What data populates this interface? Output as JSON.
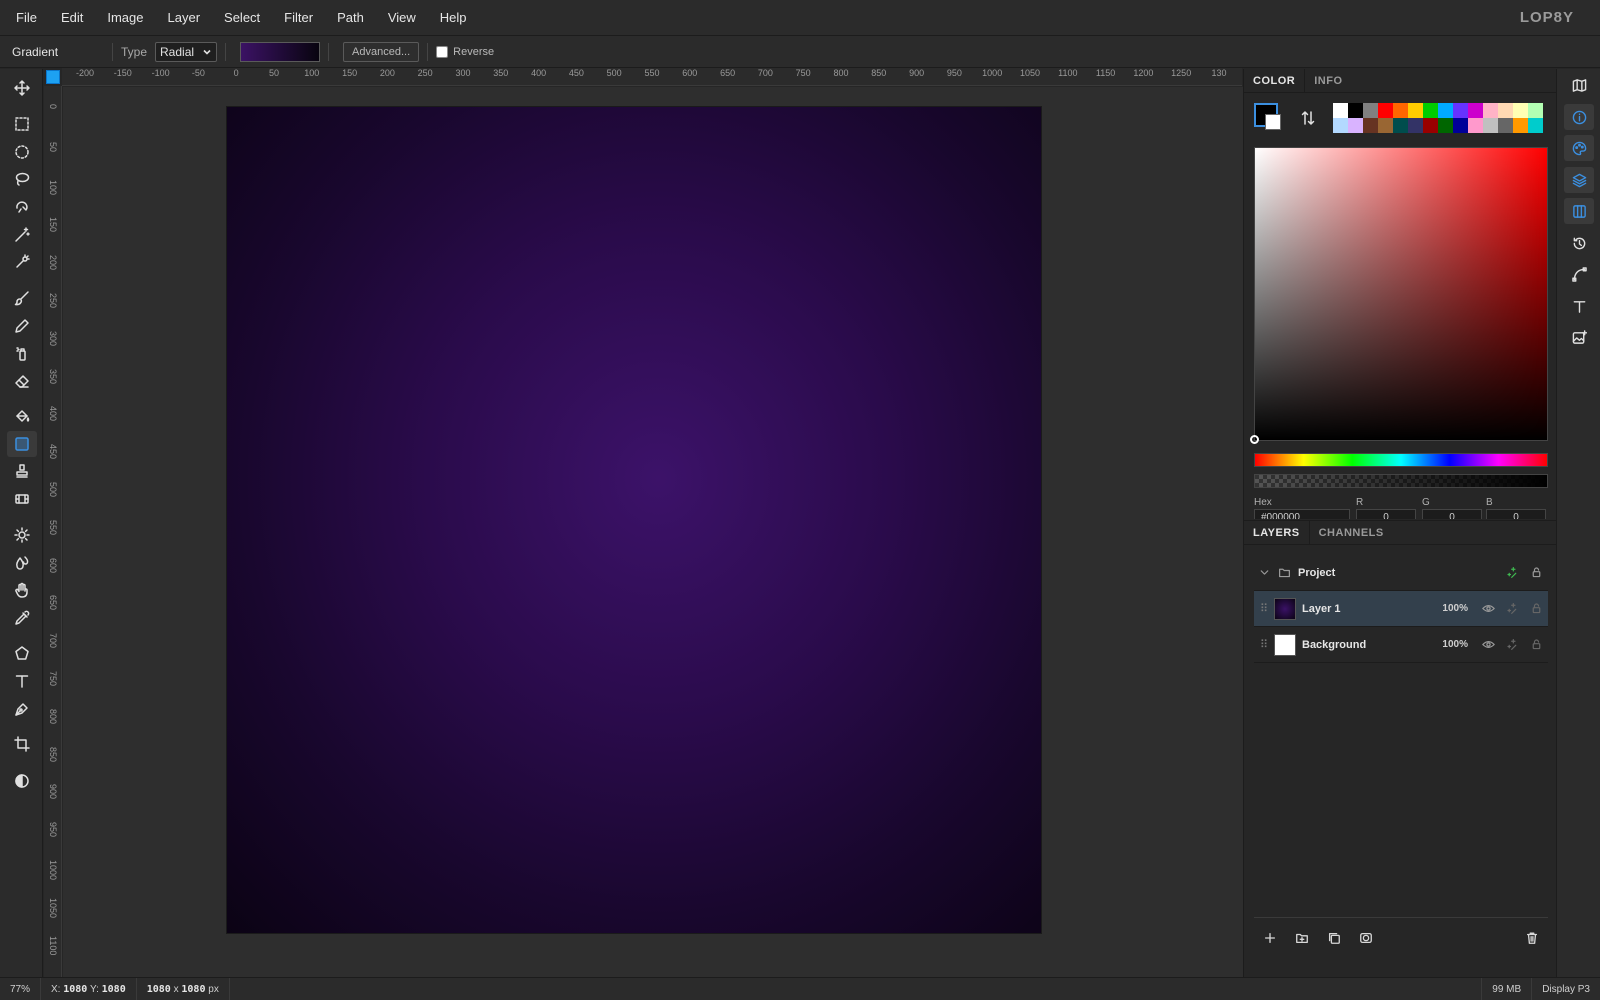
{
  "menu": [
    "File",
    "Edit",
    "Image",
    "Layer",
    "Select",
    "Filter",
    "Path",
    "View",
    "Help"
  ],
  "logo": "LOP8Y",
  "options": {
    "tool_name": "Gradient",
    "type_label": "Type",
    "type_value": "Radial",
    "advanced_label": "Advanced...",
    "reverse_label": "Reverse"
  },
  "rulers": {
    "h": [
      "-200",
      "-150",
      "-100",
      "-50",
      "0",
      "50",
      "100",
      "150",
      "200",
      "250",
      "300",
      "350",
      "400",
      "450",
      "500",
      "550",
      "600",
      "650",
      "700",
      "750",
      "800",
      "850",
      "900",
      "950",
      "1000",
      "1050",
      "1100",
      "1150",
      "1200",
      "1250",
      "130"
    ],
    "v": [
      "0",
      "50",
      "100",
      "150",
      "200",
      "250",
      "300",
      "350",
      "400",
      "450",
      "500",
      "550",
      "600",
      "650",
      "700",
      "750",
      "800",
      "850",
      "900",
      "950",
      "1000",
      "1050",
      "1100"
    ]
  },
  "tools": [
    "move-tool",
    "rect-select-tool",
    "ellipse-select-tool",
    "lasso-tool",
    "magnetic-lasso-tool",
    "magic-wand-tool",
    "quick-select-tool",
    "brush-tool",
    "pencil-tool",
    "spray-tool",
    "eraser-tool",
    "fill-tool",
    "gradient-tool",
    "stamp-tool",
    "patch-tool",
    "dodge-tool",
    "blur-tool",
    "smudge-tool",
    "eyedropper-tool",
    "shape-tool",
    "text-tool",
    "pen-tool",
    "crop-tool",
    "adjust-tool"
  ],
  "color_panel": {
    "tabs": [
      "COLOR",
      "INFO"
    ],
    "foreground": "#000000",
    "background": "#ffffff",
    "swatches": [
      "#ffffff",
      "#000000",
      "#808080",
      "#ff0000",
      "#ff6600",
      "#ffcc00",
      "#00cc00",
      "#00aaff",
      "#6633ff",
      "#cc00cc",
      "#ffb3c6",
      "#ffd9b3",
      "#ffffb3",
      "#b3ffb3",
      "#b3d9ff",
      "#d9b3ff",
      "#663322",
      "#996633",
      "#004d4d",
      "#333366",
      "#990000",
      "#006600",
      "#000099",
      "#ff99cc",
      "#c0c0c0",
      "#666666",
      "#ff9900",
      "#00cccc"
    ],
    "fields": {
      "hex_label": "Hex",
      "r_label": "R",
      "g_label": "G",
      "b_label": "B",
      "hex_value": "#000000",
      "r_value": "0",
      "g_value": "0",
      "b_value": "0"
    }
  },
  "layers_panel": {
    "tabs": [
      "LAYERS",
      "CHANNELS"
    ],
    "group": "Project",
    "layers": [
      {
        "name": "Layer 1",
        "opacity": "100%"
      },
      {
        "name": "Background",
        "opacity": "100%"
      }
    ]
  },
  "status": {
    "zoom": "77%",
    "x_label": "X:",
    "x_value": "1080",
    "y_label": "Y:",
    "y_value": "1080",
    "size_w": "1080",
    "size_x": "x",
    "size_h": "1080",
    "size_unit": "px",
    "memory": "99 MB",
    "profile": "Display P3"
  }
}
